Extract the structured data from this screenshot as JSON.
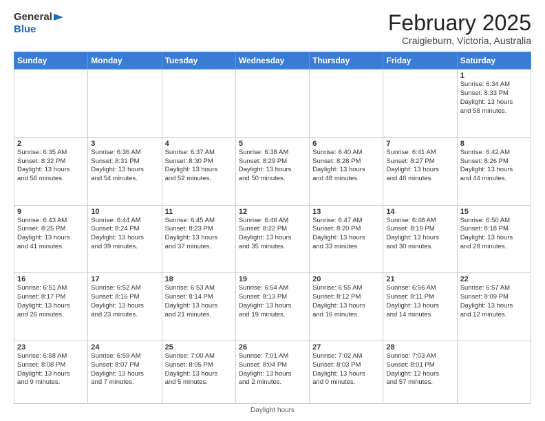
{
  "header": {
    "logo_line1": "General",
    "logo_line2": "Blue",
    "title": "February 2025",
    "subtitle": "Craigieburn, Victoria, Australia"
  },
  "days_of_week": [
    "Sunday",
    "Monday",
    "Tuesday",
    "Wednesday",
    "Thursday",
    "Friday",
    "Saturday"
  ],
  "weeks": [
    [
      {
        "day": "",
        "info": ""
      },
      {
        "day": "",
        "info": ""
      },
      {
        "day": "",
        "info": ""
      },
      {
        "day": "",
        "info": ""
      },
      {
        "day": "",
        "info": ""
      },
      {
        "day": "",
        "info": ""
      },
      {
        "day": "1",
        "info": "Sunrise: 6:34 AM\nSunset: 8:33 PM\nDaylight: 13 hours\nand 58 minutes."
      }
    ],
    [
      {
        "day": "2",
        "info": "Sunrise: 6:35 AM\nSunset: 8:32 PM\nDaylight: 13 hours\nand 56 minutes."
      },
      {
        "day": "3",
        "info": "Sunrise: 6:36 AM\nSunset: 8:31 PM\nDaylight: 13 hours\nand 54 minutes."
      },
      {
        "day": "4",
        "info": "Sunrise: 6:37 AM\nSunset: 8:30 PM\nDaylight: 13 hours\nand 52 minutes."
      },
      {
        "day": "5",
        "info": "Sunrise: 6:38 AM\nSunset: 8:29 PM\nDaylight: 13 hours\nand 50 minutes."
      },
      {
        "day": "6",
        "info": "Sunrise: 6:40 AM\nSunset: 8:28 PM\nDaylight: 13 hours\nand 48 minutes."
      },
      {
        "day": "7",
        "info": "Sunrise: 6:41 AM\nSunset: 8:27 PM\nDaylight: 13 hours\nand 46 minutes."
      },
      {
        "day": "8",
        "info": "Sunrise: 6:42 AM\nSunset: 8:26 PM\nDaylight: 13 hours\nand 44 minutes."
      }
    ],
    [
      {
        "day": "9",
        "info": "Sunrise: 6:43 AM\nSunset: 8:25 PM\nDaylight: 13 hours\nand 41 minutes."
      },
      {
        "day": "10",
        "info": "Sunrise: 6:44 AM\nSunset: 8:24 PM\nDaylight: 13 hours\nand 39 minutes."
      },
      {
        "day": "11",
        "info": "Sunrise: 6:45 AM\nSunset: 8:23 PM\nDaylight: 13 hours\nand 37 minutes."
      },
      {
        "day": "12",
        "info": "Sunrise: 6:46 AM\nSunset: 8:22 PM\nDaylight: 13 hours\nand 35 minutes."
      },
      {
        "day": "13",
        "info": "Sunrise: 6:47 AM\nSunset: 8:20 PM\nDaylight: 13 hours\nand 33 minutes."
      },
      {
        "day": "14",
        "info": "Sunrise: 6:48 AM\nSunset: 8:19 PM\nDaylight: 13 hours\nand 30 minutes."
      },
      {
        "day": "15",
        "info": "Sunrise: 6:50 AM\nSunset: 8:18 PM\nDaylight: 13 hours\nand 28 minutes."
      }
    ],
    [
      {
        "day": "16",
        "info": "Sunrise: 6:51 AM\nSunset: 8:17 PM\nDaylight: 13 hours\nand 26 minutes."
      },
      {
        "day": "17",
        "info": "Sunrise: 6:52 AM\nSunset: 8:16 PM\nDaylight: 13 hours\nand 23 minutes."
      },
      {
        "day": "18",
        "info": "Sunrise: 6:53 AM\nSunset: 8:14 PM\nDaylight: 13 hours\nand 21 minutes."
      },
      {
        "day": "19",
        "info": "Sunrise: 6:54 AM\nSunset: 8:13 PM\nDaylight: 13 hours\nand 19 minutes."
      },
      {
        "day": "20",
        "info": "Sunrise: 6:55 AM\nSunset: 8:12 PM\nDaylight: 13 hours\nand 16 minutes."
      },
      {
        "day": "21",
        "info": "Sunrise: 6:56 AM\nSunset: 8:11 PM\nDaylight: 13 hours\nand 14 minutes."
      },
      {
        "day": "22",
        "info": "Sunrise: 6:57 AM\nSunset: 8:09 PM\nDaylight: 13 hours\nand 12 minutes."
      }
    ],
    [
      {
        "day": "23",
        "info": "Sunrise: 6:58 AM\nSunset: 8:08 PM\nDaylight: 13 hours\nand 9 minutes."
      },
      {
        "day": "24",
        "info": "Sunrise: 6:59 AM\nSunset: 8:07 PM\nDaylight: 13 hours\nand 7 minutes."
      },
      {
        "day": "25",
        "info": "Sunrise: 7:00 AM\nSunset: 8:05 PM\nDaylight: 13 hours\nand 5 minutes."
      },
      {
        "day": "26",
        "info": "Sunrise: 7:01 AM\nSunset: 8:04 PM\nDaylight: 13 hours\nand 2 minutes."
      },
      {
        "day": "27",
        "info": "Sunrise: 7:02 AM\nSunset: 8:03 PM\nDaylight: 13 hours\nand 0 minutes."
      },
      {
        "day": "28",
        "info": "Sunrise: 7:03 AM\nSunset: 8:01 PM\nDaylight: 12 hours\nand 57 minutes."
      },
      {
        "day": "",
        "info": ""
      }
    ]
  ],
  "footer": "Daylight hours"
}
